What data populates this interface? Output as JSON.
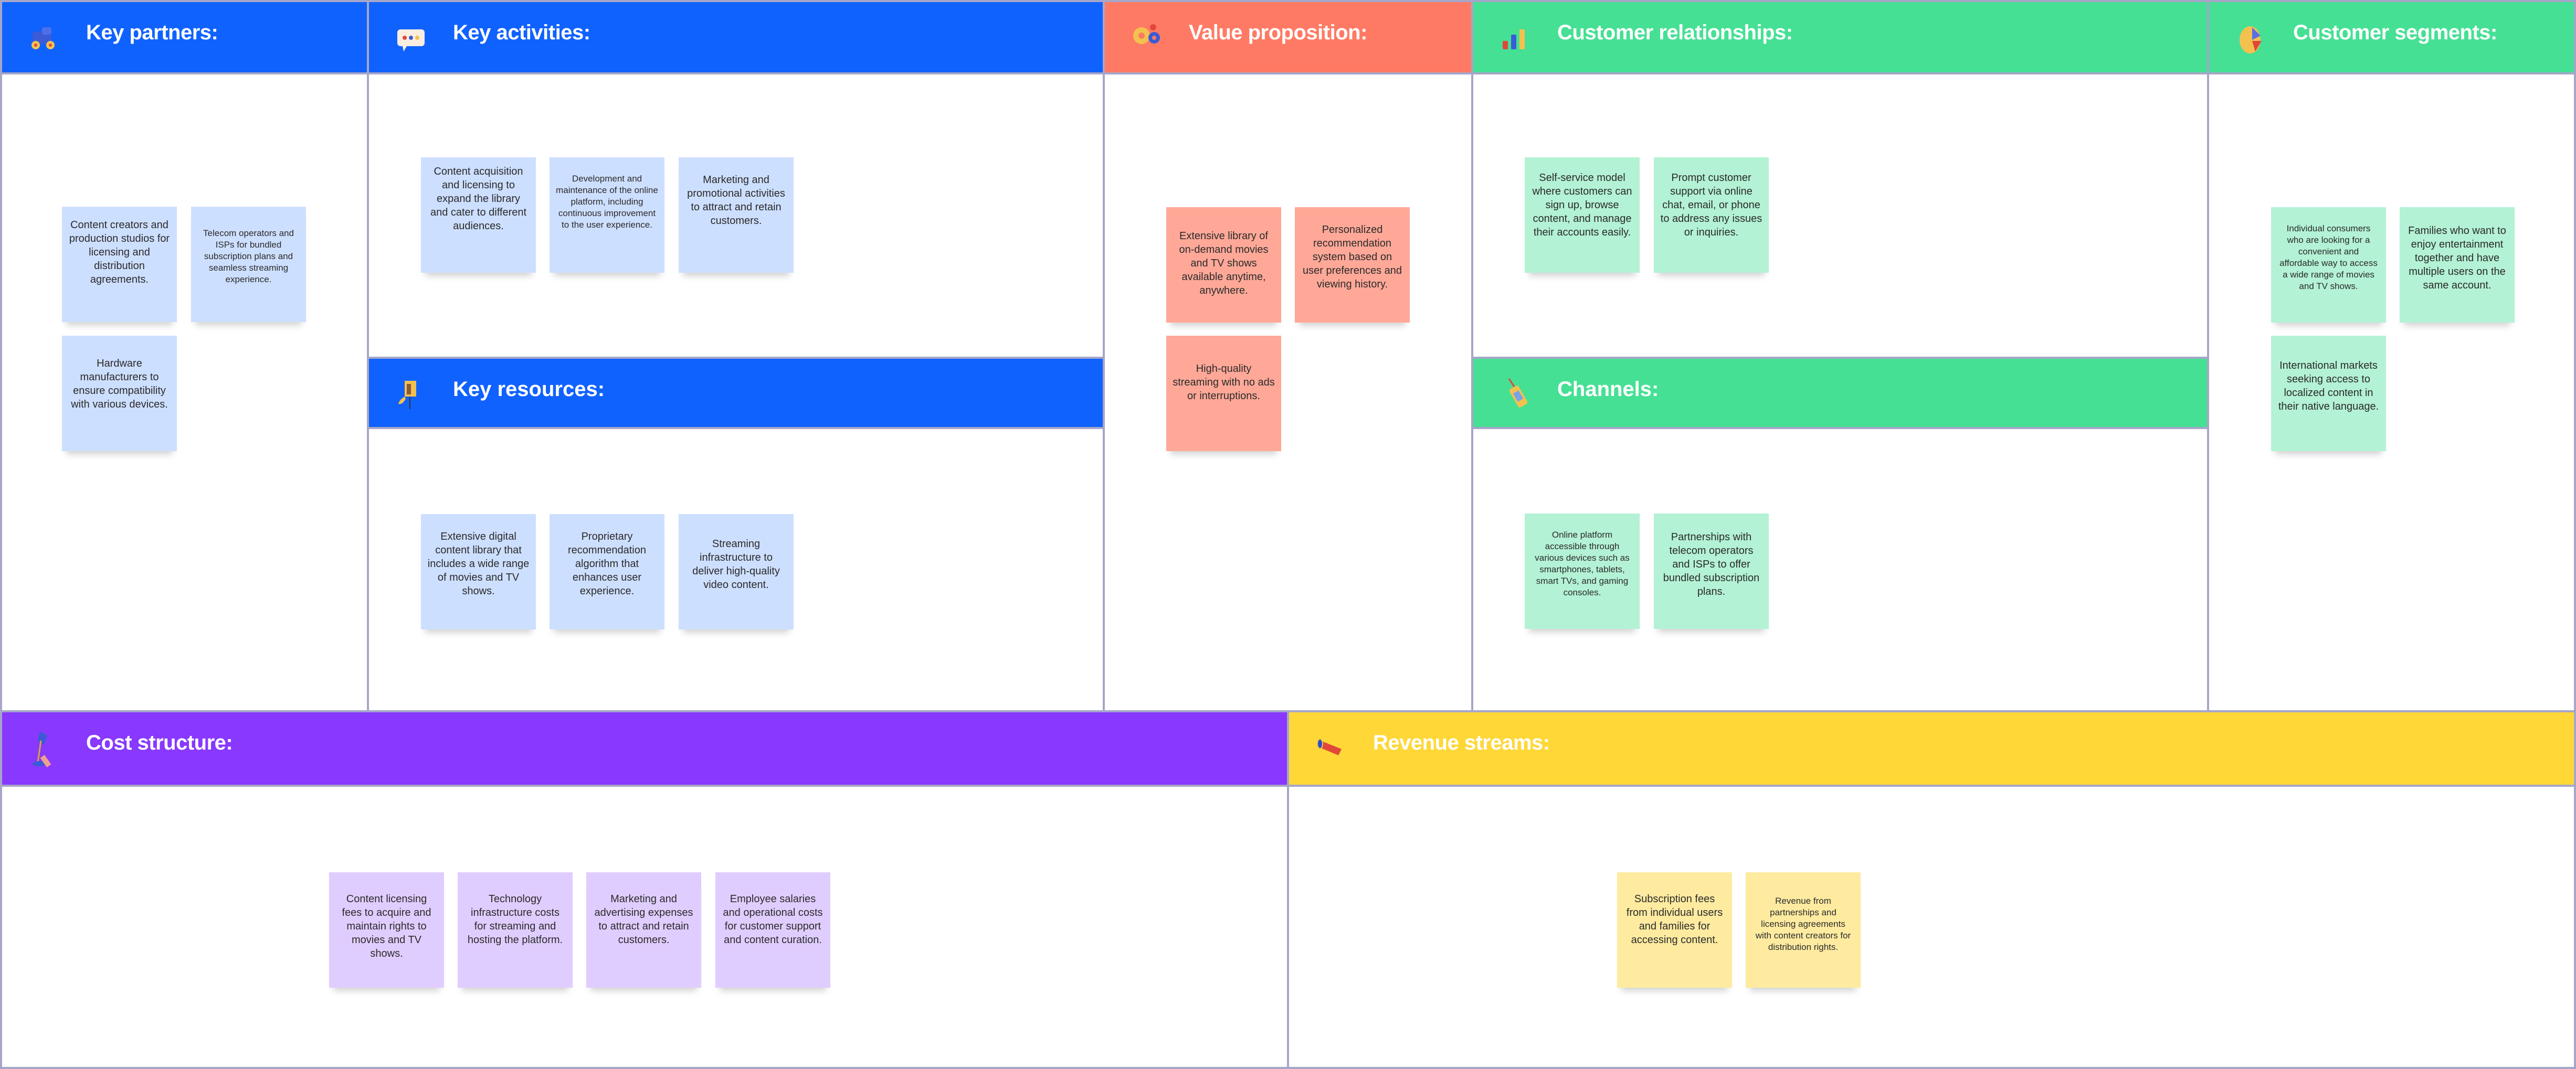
{
  "colors": {
    "blue": "#1062fe",
    "salmon": "#ff7a64",
    "green": "#45e094",
    "purple": "#8838ff",
    "yellow": "#ffd737",
    "border": "#a6a6c8"
  },
  "key_partners": {
    "title": "Key partners:",
    "icon": "toy-car-icon",
    "notes": [
      "Content creators and production studios for licensing and distribution agreements.",
      "Telecom operators and ISPs for bundled subscription plans and seamless streaming experience.",
      "Hardware manufacturers to ensure compatibility with various devices."
    ]
  },
  "key_activities": {
    "title": "Key activities:",
    "icon": "chat-bubble-icon",
    "notes": [
      "Content acquisition and licensing to expand the library and cater to different audiences.",
      "Development and maintenance of the online platform, including continuous improvement to the user experience.",
      "Marketing and promotional activities to attract and retain customers."
    ]
  },
  "key_resources": {
    "title": "Key resources:",
    "icon": "mailbox-icon",
    "notes": [
      "Extensive digital content library that includes a wide range of movies and TV shows.",
      "Proprietary recommendation algorithm that enhances user experience.",
      "Streaming infrastructure to deliver high-quality video content."
    ]
  },
  "value_proposition": {
    "title": "Value proposition:",
    "icon": "gears-icon",
    "notes": [
      "Extensive library of on-demand movies and TV shows available anytime, anywhere.",
      "Personalized recommendation system based on user preferences and viewing history.",
      "High-quality streaming with no ads or interruptions."
    ]
  },
  "customer_relationships": {
    "title": "Customer relationships:",
    "icon": "bar-chart-icon",
    "notes": [
      "Self-service model where customers can sign up, browse content, and manage their accounts easily.",
      "Prompt customer support via online chat, email, or phone to address any issues or inquiries."
    ]
  },
  "channels": {
    "title": "Channels:",
    "icon": "mobile-phone-icon",
    "notes": [
      "Online platform accessible through various devices such as smartphones, tablets, smart TVs, and gaming consoles.",
      "Partnerships with telecom operators and ISPs to offer bundled subscription plans."
    ]
  },
  "customer_segments": {
    "title": "Customer segments:",
    "icon": "pie-chart-icon",
    "notes": [
      "Individual consumers who are looking for a convenient and affordable way to access a wide range of movies and TV shows.",
      "Families who want to enjoy entertainment together and have multiple users on the same account.",
      "International markets seeking access to localized content in their native language."
    ]
  },
  "cost_structure": {
    "title": "Cost structure:",
    "icon": "desk-lamp-icon",
    "notes": [
      "Content licensing fees to acquire and maintain rights to movies and TV shows.",
      "Technology infrastructure costs for streaming and hosting the platform.",
      "Marketing and advertising expenses to attract and retain customers.",
      "Employee salaries and operational costs for customer support and content curation."
    ]
  },
  "revenue_streams": {
    "title": "Revenue streams:",
    "icon": "megaphone-icon",
    "notes": [
      "Subscription fees from individual users and families for accessing content.",
      "Revenue from partnerships and licensing agreements with content creators for distribution rights."
    ]
  }
}
